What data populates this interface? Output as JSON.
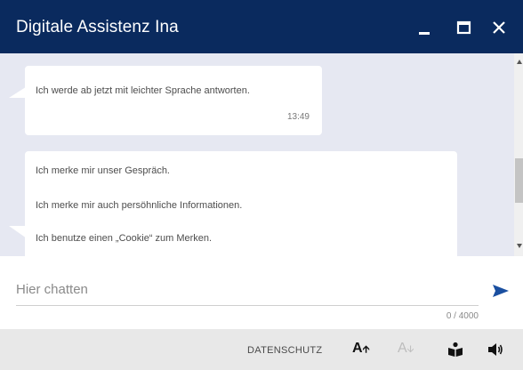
{
  "window": {
    "title": "Digitale Assistenz Ina"
  },
  "messages": [
    {
      "lines": [
        "Ich werde ab jetzt mit leichter Sprache antworten."
      ],
      "time": "13:49"
    },
    {
      "lines": [
        "Ich merke mir unser Gespräch.",
        "Ich merke mir auch persöhnliche Informationen.",
        "Ich benutze einen „Cookie“ zum Merken."
      ]
    }
  ],
  "input": {
    "placeholder": "Hier chatten",
    "value": "",
    "counter": "0 / 4000"
  },
  "toolbar": {
    "datenschutz_label": "DATENSCHUTZ",
    "font_increase_label": "A",
    "font_decrease_label": "A"
  },
  "colors": {
    "titlebar": "#0a2a5e",
    "chat_background": "#e6e8f2",
    "toolbar_background": "#e8e8e8",
    "send_icon": "#1a4fa0"
  },
  "icons": [
    "minimize-icon",
    "maximize-icon",
    "close-icon",
    "send-icon",
    "font-increase-icon",
    "font-decrease-icon",
    "easy-reading-icon",
    "speaker-icon"
  ]
}
